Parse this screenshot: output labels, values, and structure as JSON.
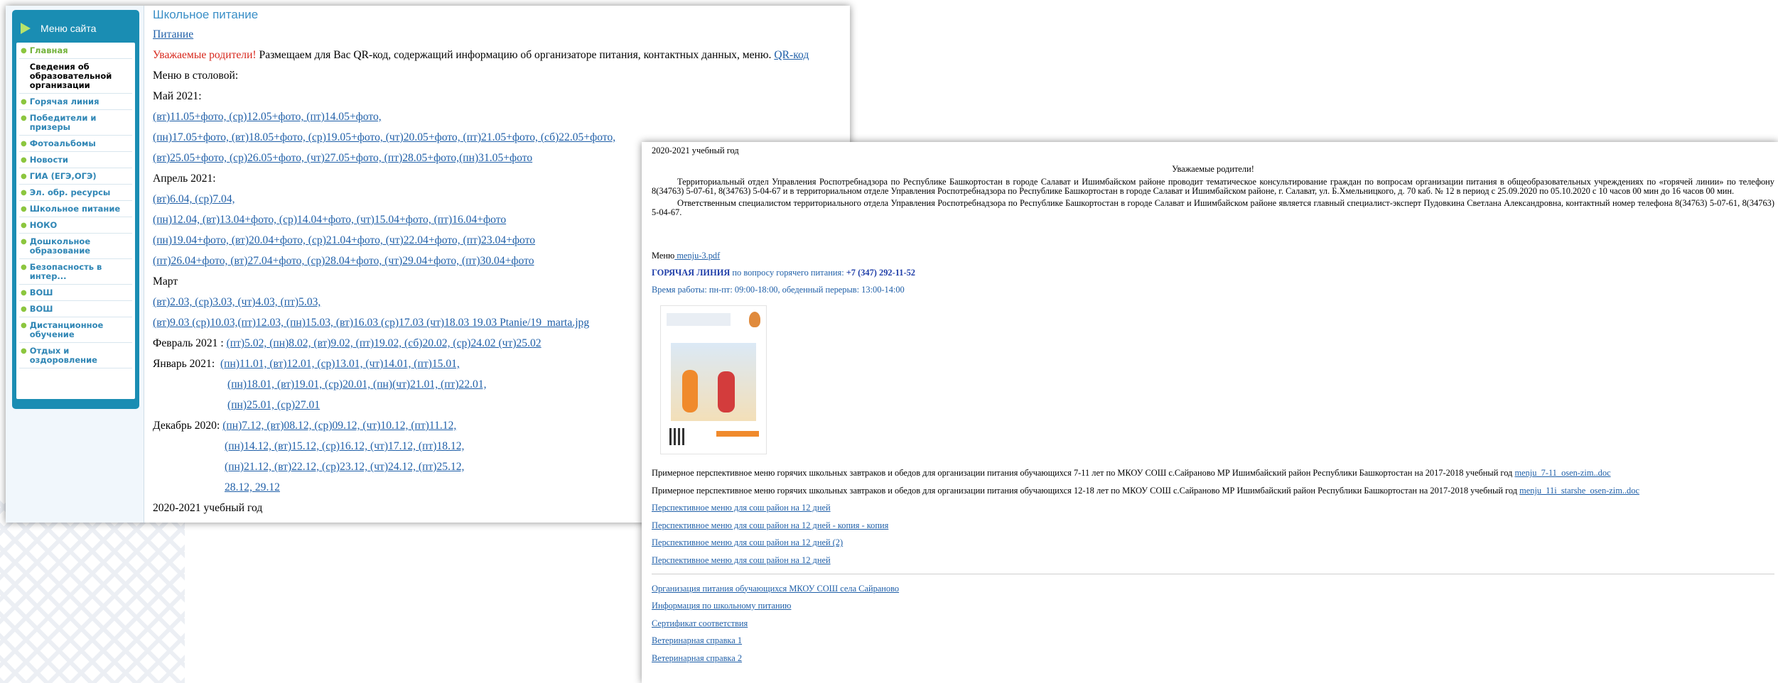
{
  "sidebar": {
    "title": "Меню сайта",
    "items": [
      {
        "label": "Главная"
      },
      {
        "label": "Сведения об образовательной организации"
      },
      {
        "label": "Горячая линия"
      },
      {
        "label": "Победители и призеры"
      },
      {
        "label": "Фотоальбомы"
      },
      {
        "label": "Новости"
      },
      {
        "label": "ГИА (ЕГЭ,ОГЭ)"
      },
      {
        "label": "Эл. обр. ресурсы"
      },
      {
        "label": "Школьное питание"
      },
      {
        "label": "НОКО"
      },
      {
        "label": "Дошкольное образование"
      },
      {
        "label": "Безопасность в интер..."
      },
      {
        "label": "ВОШ"
      },
      {
        "label": "ВОШ"
      },
      {
        "label": "Дистанционное обучение"
      },
      {
        "label": "Отдых и оздоровление"
      }
    ]
  },
  "page": {
    "title": "Школьное питание",
    "food_link": "Питание",
    "notice_red": "Уважаемые родители!",
    "notice_text": " Размещаем для Вас QR-код, содержащий информацию об организаторе питания, контактных данных, меню. ",
    "qr_link": "QR-код",
    "canteen_menu": "Меню в столовой:",
    "may": "Май 2021:",
    "may_lines": [
      "(вт)11.05+фото, (ср)12.05+фото, (пт)14.05+фото,",
      "(пн)17.05+фото, (вт)18.05+фото, (ср)19.05+фото, (чт)20.05+фото, (пт)21.05+фото, (сб)22.05+фото,",
      "(вт)25.05+фото, (ср)26.05+фото, (чт)27.05+фото, (пт)28.05+фото,(пн)31.05+фото"
    ],
    "april": "Апрель 2021:",
    "april_lines": [
      "(вт)6.04, (ср)7.04,",
      "(пн)12.04, (вт)13.04+фото, (ср)14.04+фото, (чт)15.04+фото, (пт)16.04+фото",
      "(пн)19.04+фото, (вт)20.04+фото, (ср)21.04+фото, (чт)22.04+фото, (пт)23.04+фото",
      "(пт)26.04+фото, (вт)27.04+фото, (ср)28.04+фото, (чт)29.04+фото, (пт)30.04+фото"
    ],
    "march": "Март",
    "march_lines": [
      "(вт)2.03, (ср)3.03, (чт)4.03, (пт)5.03,",
      "(вт)9.03 (ср)10.03,(пт)12.03, (пн)15.03, (вт)16.03 (ср)17.03 (чт)18.03 19.03 Ptanie/19_marta.jpg"
    ],
    "feb_label": "Февраль 2021 : ",
    "feb_links": "(пт)5.02, (пн)8.02, (вт)9.02, (пт)19.02, (сб)20.02, (ср)24.02 (чт)25.02",
    "jan_label": "Январь 2021:",
    "jan_lines": [
      "(пн)11.01, (вт)12.01, (ср)13.01, (чт)14.01, (пт)15.01,",
      "(пн)18.01, (вт)19.01, (ср)20.01, (пн)(чт)21.01, (пт)22.01,",
      "(пн)25.01, (ср)27.01"
    ],
    "dec_label": "Декабрь 2020:",
    "dec_lines": [
      "(пн)7.12, (вт)08.12, (ср)09.12, (чт)10.12, (пт)11.12,",
      "(пн)14.12, (вт)15.12, (ср)16.12, (чт)17.12, (пт)18.12,",
      "(пн)21.12, (вт)22.12, (ср)23.12, (чт)24.12, (пт)25.12,",
      "28.12, 29.12"
    ],
    "year": "2020-2021 учебный год"
  },
  "page2": {
    "year": "2020-2021 учебный год",
    "heading": "Уважаемые родители!",
    "para1": "Территориальный отдел Управления Роспотребнадзора по Республике Башкортостан в городе Салават и Ишимбайском районе проводит  тематическое консультирование граждан по вопросам организации питания в общеобразовательных учреждениях по «горячей линии» по телефону 8(34763) 5-07-61, 8(34763) 5-04-67 и в территориальном отделе Управления Роспотребнадзора по Республике Башкортостан в городе Салават и Ишимбайском районе, г. Салават, ул. Б.Хмельницкого, д. 70 каб. № 12 в период с 25.09.2020 по 05.10.2020 с 10 часов 00 мин до 16 часов 00 мин.",
    "para2": "Ответственным специалистом территориального отдела Управления Роспотребнадзора по Республике Башкортостан в городе Салават и Ишимбайском районе является главный специалист-эксперт Пудовкина Светлана Александровна, контактный номер телефона 8(34763) 5-07-61, 8(34763) 5-04-67.",
    "menu_label": "Меню",
    "menu_file": " menju-3.pdf",
    "hotline_bold": "ГОРЯЧАЯ ЛИНИЯ",
    "hotline_text": " по вопросу горячего питания:  ",
    "hotline_phone": "+7 (347) 292-11-52",
    "hours": "Время работы: пн-пт: 09:00-18:00, обеденный перерыв: 13:00-14:00",
    "menu1_text": "Примерное перспективное меню горячих школьных завтраков и обедов для организации питания обучающихся 7-11  лет по МКОУ  СОШ  с.Сайраново МР Ишимбайский район Республики Башкортостан на 2017-2018  учебный год ",
    "menu1_link": "menju_7-11_osen-zim..doc",
    "menu2_text": "Примерное перспективное меню горячих школьных завтраков и обедов для организации питания обучающихся 12-18  лет по МКОУ  СОШ  с.Сайраново МР Ишимбайский район Республики Башкортостан на 2017-2018  учебный год ",
    "menu2_link": "menju_11i_starshe_osen-zim..doc",
    "links1": [
      "Перспективное меню для сош район на 12 дней",
      "Перспективное меню для сош район на 12 дней - копия - копия",
      "Перспективное меню для сош район на 12 дней (2)",
      "Перспективное меню для сош район на 12 дней"
    ],
    "links2": [
      "Организация питания обучающихся МКОУ СОШ села Сайраново",
      "Информация по школьному питанию",
      "Сертификат соответствия",
      "Ветеринарная справка 1",
      "Ветеринарная справка 2"
    ]
  }
}
